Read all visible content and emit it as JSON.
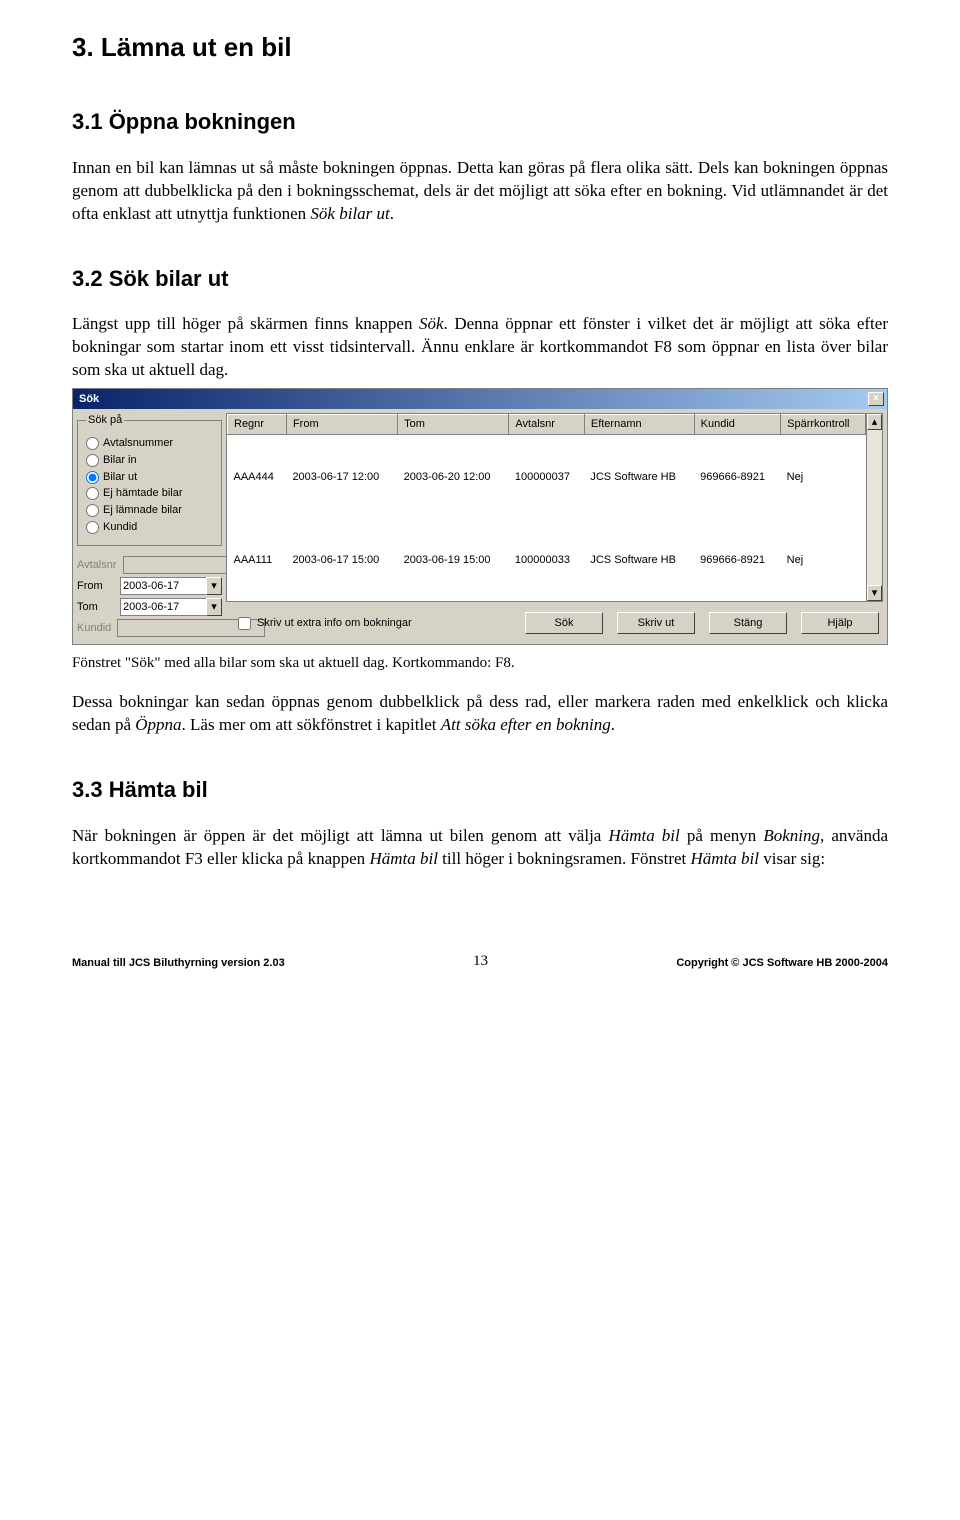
{
  "h1": "3. Lämna ut en bil",
  "h2_31": "3.1 Öppna bokningen",
  "p31": "Innan en bil kan lämnas ut så måste bokningen öppnas. Detta kan göras på flera olika sätt. Dels kan bokningen öppnas genom att dubbelklicka på den i bokningsschemat, dels är det möjligt att söka efter en bokning. Vid utlämnandet är det ofta enklast att utnyttja funktionen ",
  "p31_i": "Sök bilar ut",
  "p31_end": ".",
  "h2_32": "3.2 Sök bilar ut",
  "p32a": "Längst upp till höger på skärmen finns knappen ",
  "p32a_i": "Sök",
  "p32a2": ". Denna öppnar ett fönster i vilket det är möjligt att söka efter bokningar som startar inom ett visst tidsintervall. Ännu enklare är kortkommandot F8 som öppnar en lista över bilar som ska ut aktuell dag.",
  "win": {
    "title": "Sök",
    "close": "×",
    "legend": "Sök på",
    "radios": [
      "Avtalsnummer",
      "Bilar in",
      "Bilar ut",
      "Ej hämtade bilar",
      "Ej lämnade bilar",
      "Kundid"
    ],
    "sel_radio": 2,
    "lbl_avtalsnr": "Avtalsnr",
    "lbl_from": "From",
    "lbl_tom": "Tom",
    "lbl_kundid": "Kundid",
    "date_from": "2003-06-17",
    "date_tom": "2003-06-17",
    "cols": [
      "Regnr",
      "From",
      "Tom",
      "Avtalsnr",
      "Efternamn",
      "Kundid",
      "Spärrkontroll"
    ],
    "rows": [
      [
        "AAA444",
        "2003-06-17 12:00",
        "2003-06-20 12:00",
        "100000037",
        "JCS Software HB",
        "969666-8921",
        "Nej"
      ],
      [
        "AAA111",
        "2003-06-17 15:00",
        "2003-06-19 15:00",
        "100000033",
        "JCS Software HB",
        "969666-8921",
        "Nej"
      ]
    ],
    "chk": "Skriv ut extra info om bokningar",
    "btn_sok": "Sök",
    "btn_skriv": "Skriv ut",
    "btn_stang": "Stäng",
    "btn_hjalp": "Hjälp"
  },
  "caption": "Fönstret \"Sök\" med alla bilar som ska ut aktuell dag. Kortkommando: F8.",
  "p32b1": "Dessa bokningar kan sedan öppnas genom dubbelklick på dess rad, eller markera raden med enkelklick och klicka sedan på ",
  "p32b1_i": "Öppna",
  "p32b2": ". Läs mer om att sökfönstret i kapitlet ",
  "p32b2_i": "Att söka efter en bokning",
  "p32b3": ".",
  "h2_33": "3.3 Hämta bil",
  "p33a": "När bokningen är öppen är det möjligt att lämna ut bilen genom att välja ",
  "p33a_i1": "Hämta bil",
  "p33b": " på menyn ",
  "p33b_i": "Bokning",
  "p33c": ", använda kortkommandot F3 eller klicka på knappen ",
  "p33c_i": "Hämta bil",
  "p33d": " till höger i bokningsramen. Fönstret ",
  "p33d_i": "Hämta bil",
  "p33e": " visar sig:",
  "footer_left": "Manual till JCS Biluthyrning version 2.03",
  "footer_center": "13",
  "footer_right": "Copyright © JCS Software HB 2000-2004"
}
